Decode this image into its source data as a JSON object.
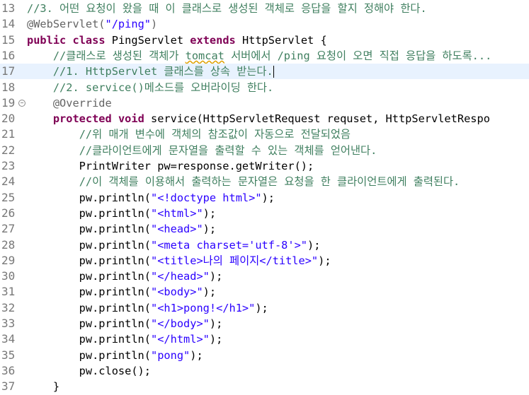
{
  "editor": {
    "lines": [
      {
        "n": "13",
        "parts": [
          [
            "cm",
            "//3. 어떤 요청이 왔을 때 이 클래스로 생성된 객체로 응답을 할지 정해야 한다."
          ]
        ]
      },
      {
        "n": "14",
        "parts": [
          [
            "an",
            "@WebServlet("
          ],
          [
            "st",
            "\"/ping\""
          ],
          [
            "an",
            ")"
          ]
        ]
      },
      {
        "n": "15",
        "parts": [
          [
            "kw",
            "public"
          ],
          [
            "",
            ""
          ],
          [
            "pl",
            " "
          ],
          [
            "kw",
            "class"
          ],
          [
            "pl",
            " PingServlet "
          ],
          [
            "kw",
            "extends"
          ],
          [
            "pl",
            " HttpServlet {"
          ]
        ]
      },
      {
        "n": "16",
        "parts": [
          [
            "pl",
            "    "
          ],
          [
            "cm",
            "//클래스로 생성된 객체가 "
          ],
          [
            "cmsq",
            "tomcat"
          ],
          [
            "cm",
            " 서버에서 /ping 요청이 오면 직접 응답을 하도록..."
          ]
        ]
      },
      {
        "n": "17",
        "current": true,
        "parts": [
          [
            "pl",
            "    "
          ],
          [
            "cm",
            "//1. HttpServlet 클래스를 상속 받는다."
          ],
          [
            "caret",
            ""
          ]
        ]
      },
      {
        "n": "18",
        "parts": [
          [
            "pl",
            "    "
          ],
          [
            "cm",
            "//2. service()메소드를 오버라이딩 한다."
          ]
        ]
      },
      {
        "n": "19",
        "fold": true,
        "parts": [
          [
            "pl",
            "    "
          ],
          [
            "an",
            "@Override"
          ]
        ]
      },
      {
        "n": "20",
        "parts": [
          [
            "pl",
            "    "
          ],
          [
            "kw",
            "protected"
          ],
          [
            "pl",
            " "
          ],
          [
            "kw",
            "void"
          ],
          [
            "pl",
            " service(HttpServletRequest requset, HttpServletRespo"
          ]
        ]
      },
      {
        "n": "21",
        "parts": [
          [
            "pl",
            "        "
          ],
          [
            "cm",
            "//위 매개 변수에 객체의 참조값이 자동으로 전달되었음"
          ]
        ]
      },
      {
        "n": "22",
        "parts": [
          [
            "pl",
            "        "
          ],
          [
            "cm",
            "//클라이언트에게 문자열을 출력할 수 있는 객체를 얻어낸다."
          ]
        ]
      },
      {
        "n": "23",
        "parts": [
          [
            "pl",
            "        PrintWriter pw=response.getWriter();"
          ]
        ]
      },
      {
        "n": "24",
        "parts": [
          [
            "pl",
            "        "
          ],
          [
            "cm",
            "//이 객체를 이용해서 출력하는 문자열은 요청을 한 클라이언트에게 출력된다."
          ]
        ]
      },
      {
        "n": "25",
        "parts": [
          [
            "pl",
            "        pw.println("
          ],
          [
            "st",
            "\"<!doctype html>\""
          ],
          [
            "pl",
            ");"
          ]
        ]
      },
      {
        "n": "26",
        "parts": [
          [
            "pl",
            "        pw.println("
          ],
          [
            "st",
            "\"<html>\""
          ],
          [
            "pl",
            ");"
          ]
        ]
      },
      {
        "n": "27",
        "parts": [
          [
            "pl",
            "        pw.println("
          ],
          [
            "st",
            "\"<head>\""
          ],
          [
            "pl",
            ");"
          ]
        ]
      },
      {
        "n": "28",
        "parts": [
          [
            "pl",
            "        pw.println("
          ],
          [
            "st",
            "\"<meta charset='utf-8'>\""
          ],
          [
            "pl",
            ");"
          ]
        ]
      },
      {
        "n": "29",
        "parts": [
          [
            "pl",
            "        pw.println("
          ],
          [
            "st",
            "\"<title>나의 페이지</title>\""
          ],
          [
            "pl",
            ");"
          ]
        ]
      },
      {
        "n": "30",
        "parts": [
          [
            "pl",
            "        pw.println("
          ],
          [
            "st",
            "\"</head>\""
          ],
          [
            "pl",
            ");"
          ]
        ]
      },
      {
        "n": "31",
        "parts": [
          [
            "pl",
            "        pw.println("
          ],
          [
            "st",
            "\"<body>\""
          ],
          [
            "pl",
            ");"
          ]
        ]
      },
      {
        "n": "32",
        "parts": [
          [
            "pl",
            "        pw.println("
          ],
          [
            "st",
            "\"<h1>pong!</h1>\""
          ],
          [
            "pl",
            ");"
          ]
        ]
      },
      {
        "n": "33",
        "parts": [
          [
            "pl",
            "        pw.println("
          ],
          [
            "st",
            "\"</body>\""
          ],
          [
            "pl",
            ");"
          ]
        ]
      },
      {
        "n": "34",
        "parts": [
          [
            "pl",
            "        pw.println("
          ],
          [
            "st",
            "\"</html>\""
          ],
          [
            "pl",
            ");"
          ]
        ]
      },
      {
        "n": "35",
        "parts": [
          [
            "pl",
            "        pw.println("
          ],
          [
            "st",
            "\"pong\""
          ],
          [
            "pl",
            ");"
          ]
        ]
      },
      {
        "n": "36",
        "parts": [
          [
            "pl",
            "        pw.close();"
          ]
        ]
      },
      {
        "n": "37",
        "parts": [
          [
            "pl",
            "    }"
          ]
        ]
      }
    ]
  }
}
